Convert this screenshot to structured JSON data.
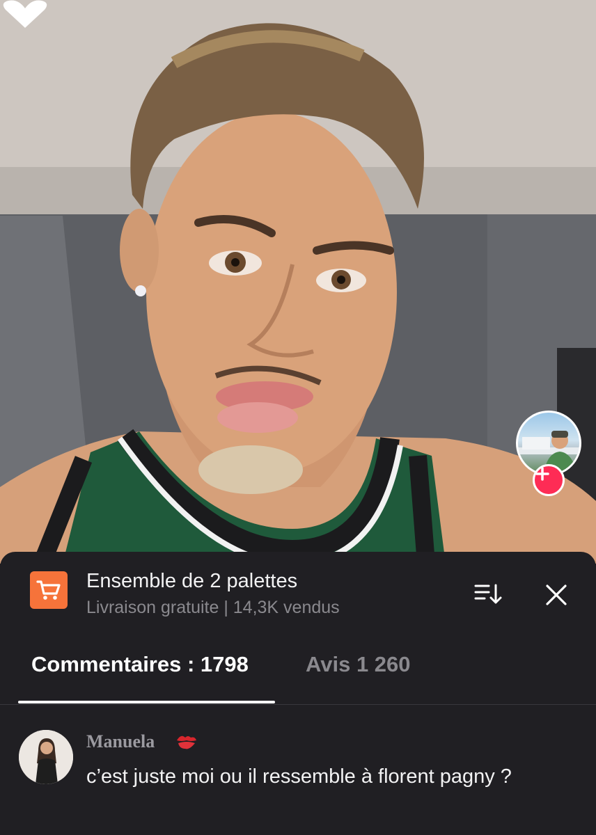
{
  "video": {
    "creator_avatar": "creator-profile-photo",
    "follow_icon": "plus-icon",
    "like_icon": "heart-icon"
  },
  "product": {
    "icon": "shopping-cart-icon",
    "title": "Ensemble de 2 palettes",
    "subtitle": "Livraison gratuite | 14,3K vendus",
    "accent_color": "#f6733a"
  },
  "header_actions": {
    "sort_icon": "sort-icon",
    "close_icon": "close-icon"
  },
  "tabs": [
    {
      "label": "Commentaires : 1798",
      "active": true
    },
    {
      "label": "Avis 1 260",
      "active": false
    }
  ],
  "comments": [
    {
      "author": "Manuela",
      "author_emoji": "kiss-mark-icon",
      "text": "c’est juste moi ou il ressemble à florent pagny ?"
    }
  ],
  "colors": {
    "sheet_bg": "#201f23",
    "follow_red": "#fe2c55",
    "muted_text": "#8a898e"
  }
}
